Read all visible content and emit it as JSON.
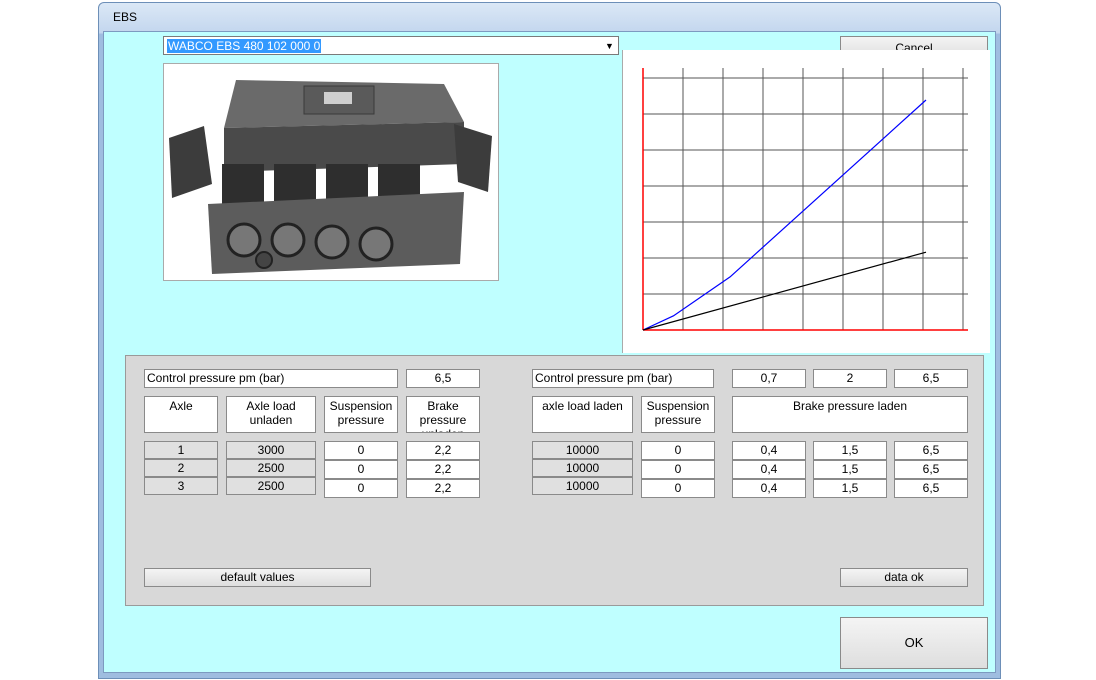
{
  "window": {
    "title": "EBS"
  },
  "device_select": {
    "value": "WABCO EBS 480 102 000 0"
  },
  "buttons": {
    "cancel": "Cancel",
    "default_values": "default values",
    "data_ok": "data ok",
    "ok": "OK"
  },
  "left_table": {
    "control_pressure_label": "Control pressure pm (bar)",
    "control_pressure_value": "6,5",
    "headers": {
      "axle": "Axle",
      "axle_load_unladen": "Axle load unladen",
      "suspension_pressure": "Suspension pressure",
      "brake_pressure": "Brake pressure unladen"
    },
    "rows": [
      {
        "axle": "1",
        "load": "3000",
        "suspension": "0",
        "brake": "2,2"
      },
      {
        "axle": "2",
        "load": "2500",
        "suspension": "0",
        "brake": "2,2"
      },
      {
        "axle": "3",
        "load": "2500",
        "suspension": "0",
        "brake": "2,2"
      }
    ]
  },
  "right_table": {
    "control_pressure_label": "Control pressure pm (bar)",
    "control_pressure_values": [
      "0,7",
      "2",
      "6,5"
    ],
    "headers": {
      "axle_load_laden": "axle load laden",
      "suspension_pressure": "Suspension pressure",
      "brake_pressure_laden": "Brake pressure laden"
    },
    "rows": [
      {
        "load": "10000",
        "suspension": "0",
        "brake": [
          "0,4",
          "1,5",
          "6,5"
        ]
      },
      {
        "load": "10000",
        "suspension": "0",
        "brake": [
          "0,4",
          "1,5",
          "6,5"
        ]
      },
      {
        "load": "10000",
        "suspension": "0",
        "brake": [
          "0,4",
          "1,5",
          "6,5"
        ]
      }
    ]
  },
  "chart_data": {
    "type": "line",
    "title": "",
    "xlabel": "",
    "ylabel": "",
    "xlim": [
      0,
      6.5
    ],
    "ylim": [
      0,
      6.5
    ],
    "grid": true,
    "series": [
      {
        "x": [
          0,
          0.7,
          2,
          6.5
        ],
        "y": [
          0,
          0.4,
          1.5,
          6.5
        ],
        "color": "#0000ff"
      },
      {
        "x": [
          0,
          6.5
        ],
        "y": [
          0,
          2.2
        ],
        "color": "#000000"
      }
    ]
  },
  "colors": {
    "client_bg": "#bfffff",
    "panel_bg": "#d8d8d8",
    "chart_axis": "#ff0000",
    "laden_line": "#0000ff",
    "unladen_line": "#000000"
  }
}
